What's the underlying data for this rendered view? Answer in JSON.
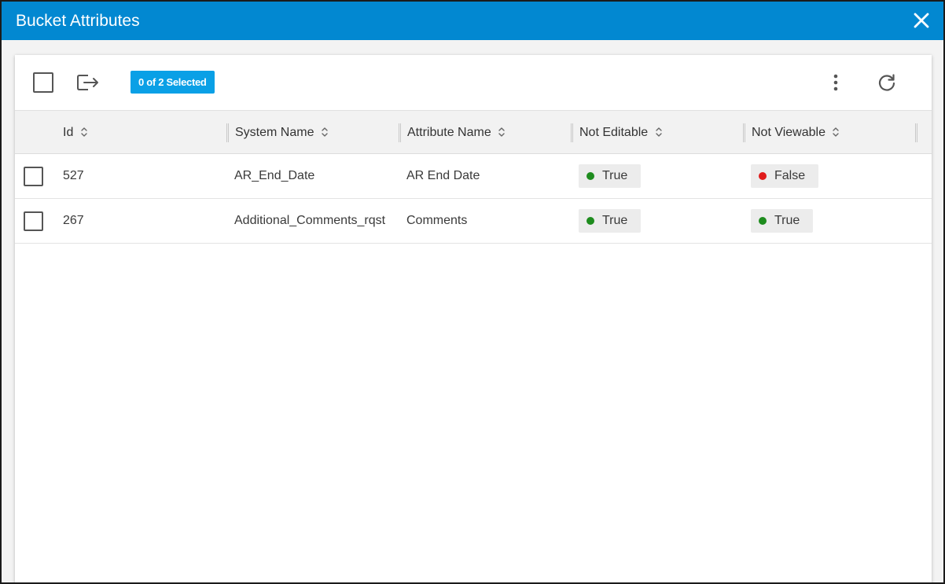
{
  "dialog": {
    "title": "Bucket Attributes"
  },
  "toolbar": {
    "selected_label": "0 of 2 Selected"
  },
  "columns": {
    "id": "Id",
    "system_name": "System Name",
    "attribute_name": "Attribute Name",
    "not_editable": "Not Editable",
    "not_viewable": "Not Viewable"
  },
  "rows": [
    {
      "id": "527",
      "system_name": "AR_End_Date",
      "attribute_name": "AR End Date",
      "not_editable": "True",
      "not_viewable": "False"
    },
    {
      "id": "267",
      "system_name": "Additional_Comments_rqst",
      "attribute_name": "Comments",
      "not_editable": "True",
      "not_viewable": "True"
    }
  ],
  "colors": {
    "title_bar": "#0288d1",
    "badge": "#0aa0e6",
    "true_dot": "#1e8c1e",
    "false_dot": "#e01b1b"
  },
  "icons": {
    "close": "close-icon",
    "export": "export-icon",
    "more": "more-vertical-icon",
    "refresh": "refresh-icon",
    "sort": "sort-icon"
  }
}
